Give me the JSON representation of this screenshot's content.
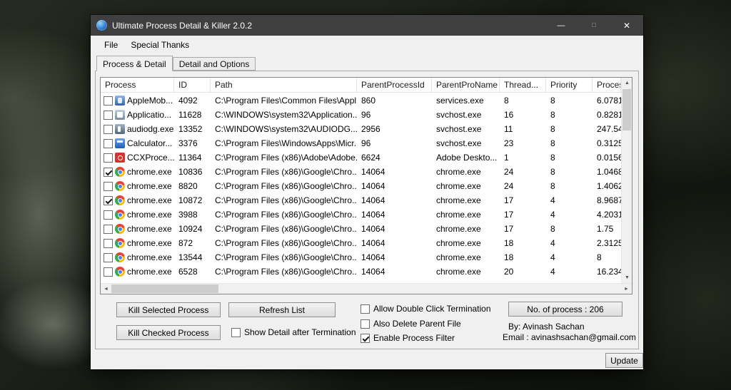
{
  "window": {
    "title": "Ultimate Process Detail & Killer 2.0.2",
    "controls": {
      "minimize": "—",
      "maximize": "□",
      "close": "✕"
    }
  },
  "menu": {
    "items": [
      "File",
      "Special Thanks"
    ]
  },
  "tabs": [
    {
      "label": "Process & Detail",
      "active": true
    },
    {
      "label": "Detail and Options",
      "active": false
    }
  ],
  "list": {
    "columns": [
      "Process",
      "ID",
      "Path",
      "ParentProcessId",
      "ParentProName",
      "Thread...",
      "Priority",
      "Proces..."
    ],
    "rows": [
      {
        "checked": false,
        "icon": "apple-mobile",
        "process": "AppleMob...",
        "id": "4092",
        "path": "C:\\Program Files\\Common Files\\Appl...",
        "parent_id": "860",
        "parent_name": "services.exe",
        "threads": "8",
        "priority": "8",
        "cpu": "6.0781"
      },
      {
        "checked": false,
        "icon": "app-frame",
        "process": "Applicatio...",
        "id": "11628",
        "path": "C:\\WINDOWS\\system32\\Application...",
        "parent_id": "96",
        "parent_name": "svchost.exe",
        "threads": "16",
        "priority": "8",
        "cpu": "0.8281"
      },
      {
        "checked": false,
        "icon": "audiodg",
        "process": "audiodg.exe",
        "id": "13352",
        "path": "C:\\WINDOWS\\system32\\AUDIODG...",
        "parent_id": "2956",
        "parent_name": "svchost.exe",
        "threads": "11",
        "priority": "8",
        "cpu": "247.54"
      },
      {
        "checked": false,
        "icon": "calculator",
        "process": "Calculator...",
        "id": "3376",
        "path": "C:\\Program Files\\WindowsApps\\Micr...",
        "parent_id": "96",
        "parent_name": "svchost.exe",
        "threads": "23",
        "priority": "8",
        "cpu": "0.3125"
      },
      {
        "checked": false,
        "icon": "adobe-ccx",
        "process": "CCXProce...",
        "id": "11364",
        "path": "C:\\Program Files (x86)\\Adobe\\Adobe...",
        "parent_id": "6624",
        "parent_name": "Adobe Deskto...",
        "threads": "1",
        "priority": "8",
        "cpu": "0.0156"
      },
      {
        "checked": true,
        "icon": "chrome",
        "process": "chrome.exe",
        "id": "10836",
        "path": "C:\\Program Files (x86)\\Google\\Chro...",
        "parent_id": "14064",
        "parent_name": "chrome.exe",
        "threads": "24",
        "priority": "8",
        "cpu": "1.0468"
      },
      {
        "checked": false,
        "icon": "chrome",
        "process": "chrome.exe",
        "id": "8820",
        "path": "C:\\Program Files (x86)\\Google\\Chro...",
        "parent_id": "14064",
        "parent_name": "chrome.exe",
        "threads": "24",
        "priority": "8",
        "cpu": "1.4062"
      },
      {
        "checked": true,
        "icon": "chrome",
        "process": "chrome.exe",
        "id": "10872",
        "path": "C:\\Program Files (x86)\\Google\\Chro...",
        "parent_id": "14064",
        "parent_name": "chrome.exe",
        "threads": "17",
        "priority": "4",
        "cpu": "8.9687"
      },
      {
        "checked": false,
        "icon": "chrome",
        "process": "chrome.exe",
        "id": "3988",
        "path": "C:\\Program Files (x86)\\Google\\Chro...",
        "parent_id": "14064",
        "parent_name": "chrome.exe",
        "threads": "17",
        "priority": "4",
        "cpu": "4.2031"
      },
      {
        "checked": false,
        "icon": "chrome",
        "process": "chrome.exe",
        "id": "10924",
        "path": "C:\\Program Files (x86)\\Google\\Chro...",
        "parent_id": "14064",
        "parent_name": "chrome.exe",
        "threads": "17",
        "priority": "8",
        "cpu": "1.75"
      },
      {
        "checked": false,
        "icon": "chrome",
        "process": "chrome.exe",
        "id": "872",
        "path": "C:\\Program Files (x86)\\Google\\Chro...",
        "parent_id": "14064",
        "parent_name": "chrome.exe",
        "threads": "18",
        "priority": "4",
        "cpu": "2.3125"
      },
      {
        "checked": false,
        "icon": "chrome",
        "process": "chrome.exe",
        "id": "13544",
        "path": "C:\\Program Files (x86)\\Google\\Chro...",
        "parent_id": "14064",
        "parent_name": "chrome.exe",
        "threads": "18",
        "priority": "4",
        "cpu": "8"
      },
      {
        "checked": false,
        "icon": "chrome",
        "process": "chrome.exe",
        "id": "6528",
        "path": "C:\\Program Files (x86)\\Google\\Chro...",
        "parent_id": "14064",
        "parent_name": "chrome.exe",
        "threads": "20",
        "priority": "4",
        "cpu": "16.234"
      }
    ]
  },
  "buttons": {
    "kill_selected": "Kill Selected Process",
    "refresh": "Refresh List",
    "kill_checked": "Kill Checked Process",
    "update": "Update"
  },
  "options": {
    "allow_double_click": {
      "label": "Allow Double Click Termination",
      "checked": false
    },
    "also_delete_parent": {
      "label": "Also Delete Parent File",
      "checked": false
    },
    "enable_filter": {
      "label": "Enable Process Filter",
      "checked": true
    },
    "show_detail": {
      "label": "Show Detail after Termination",
      "checked": false
    }
  },
  "status": {
    "process_count": "No. of process : 206",
    "author": "By: Avinash Sachan",
    "email": "Email : avinashsachan@gmail.com"
  },
  "icons": {
    "scroll_up": "▲",
    "scroll_down": "▼",
    "scroll_left": "◄",
    "scroll_right": "►"
  },
  "colors": {
    "titlebar": "#3f3f3f",
    "chrome_red": "#ea4335",
    "chrome_yellow": "#fbbc05",
    "chrome_green": "#34a853",
    "chrome_blue": "#4285f4",
    "adobe_red": "#d6342c"
  }
}
